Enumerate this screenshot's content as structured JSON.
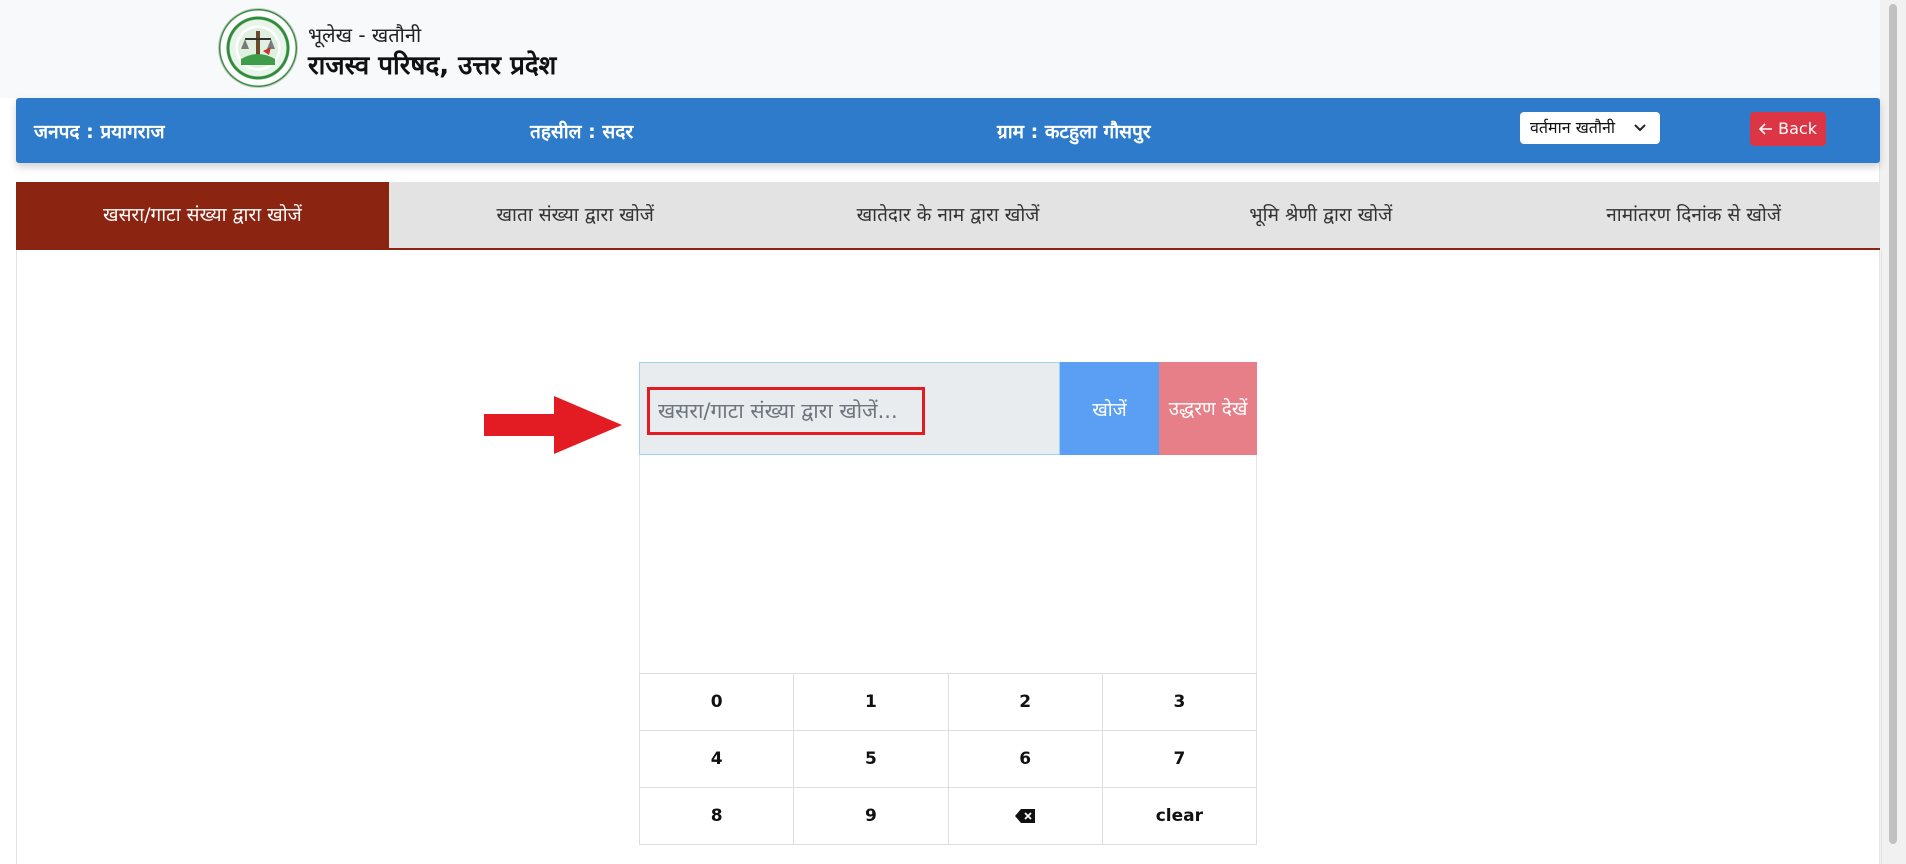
{
  "header": {
    "subtitle": "भूलेख - खतौनी",
    "title": "राजस्व परिषद, उत्तर प्रदेश"
  },
  "info_bar": {
    "district": "जनपद : प्रयागराज",
    "tehsil": "तहसील : सदर",
    "village": "ग्राम : कटहुला गौसपुर",
    "khatauni_select": "वर्तमान खतौनी",
    "back_label": "Back"
  },
  "tabs": [
    {
      "label": "खसरा/गाटा संख्या द्वारा खोजें",
      "active": true
    },
    {
      "label": "खाता संख्या द्वारा खोजें",
      "active": false
    },
    {
      "label": "खातेदार के नाम द्वारा खोजें",
      "active": false
    },
    {
      "label": "भूमि श्रेणी द्वारा खोजें",
      "active": false
    },
    {
      "label": "नामांतरण दिनांक से खोजें",
      "active": false
    }
  ],
  "search": {
    "placeholder": "खसरा/गाटा संख्या द्वारा खोजें...",
    "value": "",
    "search_label": "खोजें",
    "view_label": "उद्धरण देखें"
  },
  "keypad": {
    "keys": [
      "0",
      "1",
      "2",
      "3",
      "4",
      "5",
      "6",
      "7",
      "8",
      "9",
      "backspace-icon",
      "clear"
    ]
  },
  "colors": {
    "bar_blue": "#2d7bca",
    "tab_active": "#8b2512",
    "search_button": "#5b9ff5",
    "view_button": "#e77f88",
    "back_button": "#dc3545",
    "highlight": "#e31b23"
  }
}
